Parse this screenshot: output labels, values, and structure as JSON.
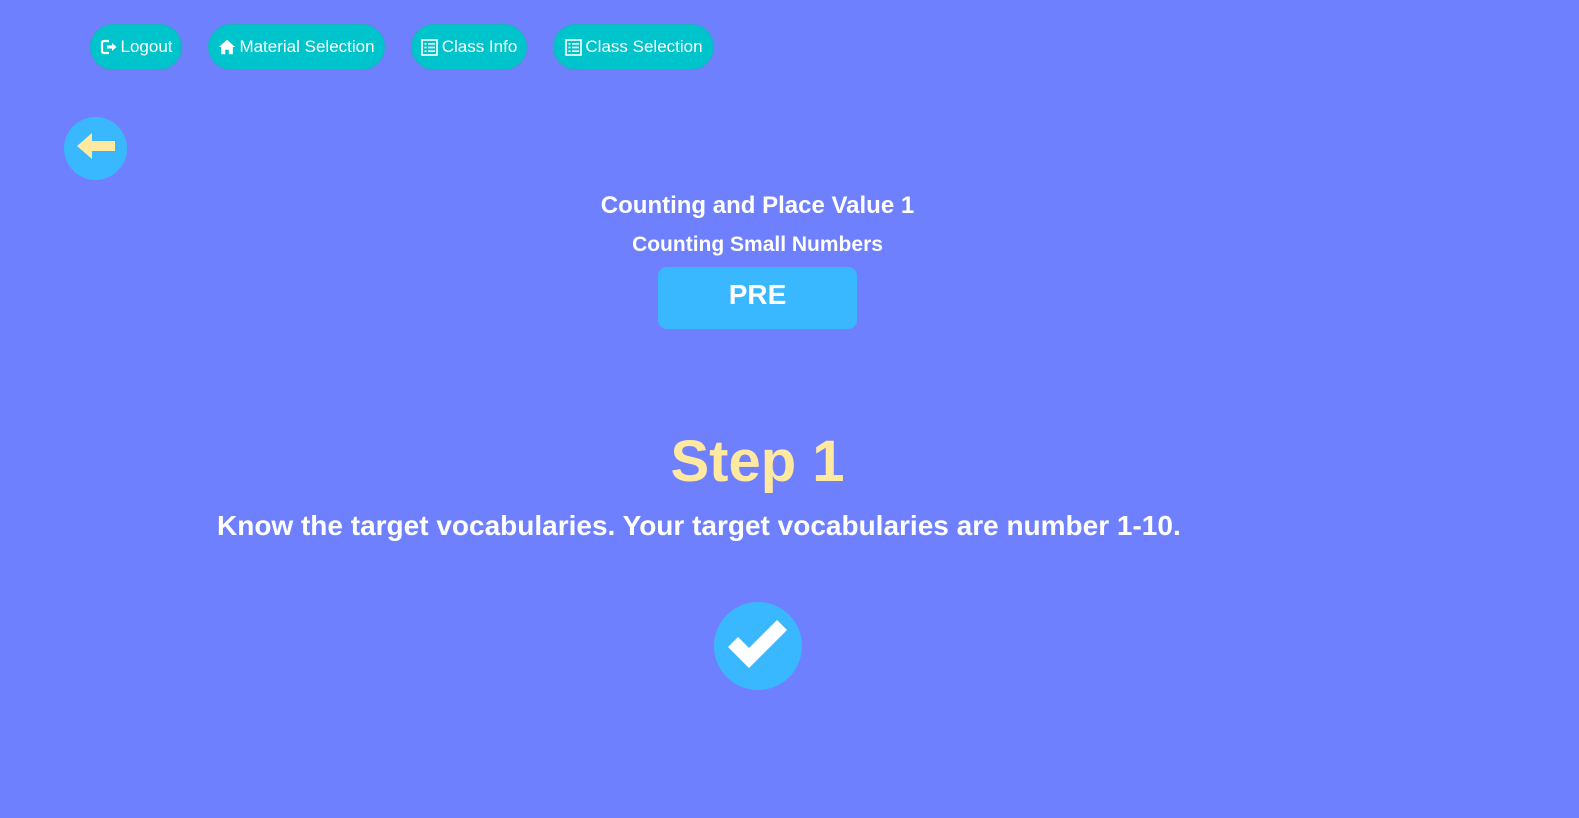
{
  "nav": {
    "items": [
      {
        "label": "Logout",
        "icon": "logout-icon"
      },
      {
        "label": "Material Selection",
        "icon": "home-icon"
      },
      {
        "label": "Class Info",
        "icon": "list-icon"
      },
      {
        "label": "Class Selection",
        "icon": "list-icon"
      }
    ]
  },
  "back": {
    "icon": "arrow-left-icon"
  },
  "material": {
    "title": "Counting and Place Value 1",
    "subtitle": "Counting Small Numbers",
    "phase": "PRE"
  },
  "step": {
    "heading": "Step 1",
    "description": "Know the target vocabularies. Your target vocabularies are number 1-10."
  },
  "confirm": {
    "icon": "checkmark-icon"
  },
  "colors": {
    "background": "#6f80ff",
    "nav_pill": "#00c4cc",
    "accent_blue": "#3ab8ff",
    "step_heading": "#ffe9a0",
    "back_arrow": "#ffe9a0",
    "text": "#ffffff"
  }
}
